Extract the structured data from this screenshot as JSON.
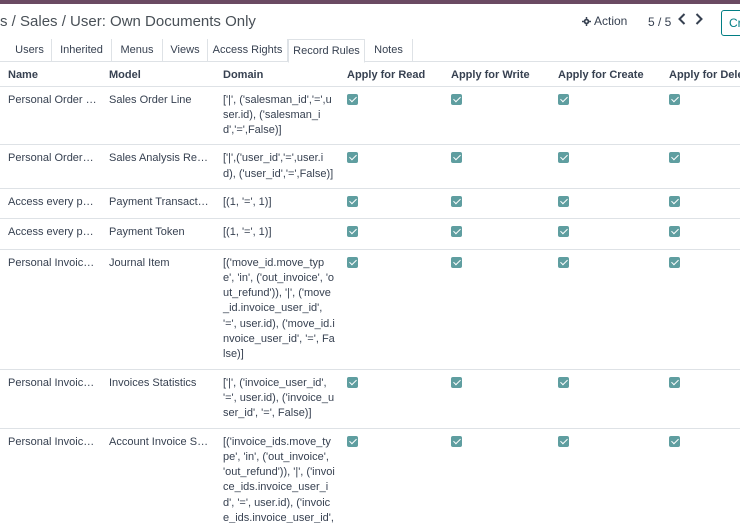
{
  "header": {
    "breadcrumb_prefix": "s",
    "breadcrumb_title": "Sales / User: Own Documents Only",
    "action_label": "Action",
    "pager_text": "5 / 5",
    "create_label": "Cr"
  },
  "tabs": [
    {
      "label": "Users"
    },
    {
      "label": "Inherited"
    },
    {
      "label": "Menus"
    },
    {
      "label": "Views"
    },
    {
      "label": "Access Rights"
    },
    {
      "label": "Record Rules",
      "active": true
    },
    {
      "label": "Notes"
    }
  ],
  "table": {
    "columns": [
      "Name",
      "Model",
      "Domain",
      "Apply for Read",
      "Apply for Write",
      "Apply for Create",
      "Apply for Delete"
    ],
    "rows": [
      {
        "name": "Personal Order Lines",
        "model": "Sales Order Line",
        "domain": "['|', ('salesman_id','=',user.id), ('salesman_id','=',False)]",
        "read": true,
        "write": true,
        "create": true,
        "delete": true
      },
      {
        "name": "Personal Orders Analysis",
        "model": "Sales Analysis Report",
        "domain": "['|',('user_id','=',user.id), ('user_id','=',False)]",
        "read": true,
        "write": true,
        "create": true,
        "delete": true
      },
      {
        "name": "Access every payment transaction",
        "model": "Payment Transaction",
        "domain": "[(1, '=', 1)]",
        "read": true,
        "write": true,
        "create": true,
        "delete": true
      },
      {
        "name": "Access every payment token",
        "model": "Payment Token",
        "domain": "[(1, '=', 1)]",
        "read": true,
        "write": true,
        "create": true,
        "delete": true
      },
      {
        "name": "Personal Invoice Lines",
        "model": "Journal Item",
        "domain": "[('move_id.move_type', 'in', ('out_invoice', 'out_refund')), '|', ('move_id.invoice_user_id', '=', user.id), ('move_id.invoice_user_id', '=', False)]",
        "read": true,
        "write": true,
        "create": true,
        "delete": true
      },
      {
        "name": "Personal Invoices Analysis",
        "model": "Invoices Statistics",
        "domain": "['|', ('invoice_user_id', '=', user.id), ('invoice_user_id', '=', False)]",
        "read": true,
        "write": true,
        "create": true,
        "delete": true
      },
      {
        "name": "Personal Invoice Send",
        "model": "Account Invoice Send",
        "domain": "[('invoice_ids.move_type', 'in', ('out_invoice', 'out_refund')), '|', ('invoice_ids.invoice_user_id', '=', user.id), ('invoice_ids.invoice_user_id', '=', False)]",
        "read": true,
        "write": true,
        "create": true,
        "delete": true
      }
    ]
  },
  "colors": {
    "topbar": "#6b4a63",
    "checkbox": "#5f9ea0",
    "accent": "#017e84"
  },
  "icons": {
    "action": "gear-icon",
    "prev": "chevron-left-icon",
    "next": "chevron-right-icon"
  }
}
